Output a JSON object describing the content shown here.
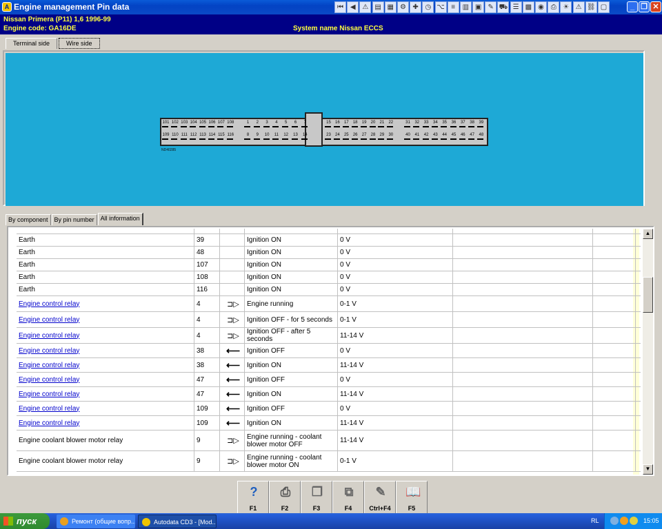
{
  "window": {
    "title": "Engine management Pin data",
    "app_icon": "autodata-icon"
  },
  "toolbar_icons": [
    "first-icon",
    "prev-icon",
    "warning-icon",
    "doc-icon",
    "chart-icon",
    "gear-icon",
    "tools-icon",
    "clock-icon",
    "tree-icon",
    "list-icon",
    "book-icon",
    "doc2-icon",
    "wrench-icon",
    "car-icon",
    "form-icon",
    "image-icon",
    "camera-icon",
    "print-icon",
    "bulb-icon",
    "warning2-icon",
    "link-icon",
    "frame-icon"
  ],
  "info": {
    "vehicle": "Nissan  Primera (P11) 1,6  1996-99",
    "engine_code": "Engine code: GA16DE",
    "system_name": "System name Nissan ECCS"
  },
  "view_tabs": [
    "Terminal side",
    "Wire side"
  ],
  "connector": {
    "code": "ND40285",
    "top_left": [
      "101",
      "102",
      "103",
      "104",
      "105",
      "106",
      "107",
      "108"
    ],
    "bottom_left": [
      "109",
      "110",
      "111",
      "112",
      "113",
      "114",
      "115",
      "116"
    ],
    "top_mid": [
      "1",
      "2",
      "3",
      "4",
      "5",
      "6",
      "7"
    ],
    "bottom_mid": [
      "8",
      "9",
      "10",
      "11",
      "12",
      "13",
      "14"
    ],
    "top_right_a": [
      "15",
      "16",
      "17",
      "18",
      "19",
      "20",
      "21",
      "22"
    ],
    "bottom_right_a": [
      "23",
      "24",
      "25",
      "26",
      "27",
      "28",
      "29",
      "30"
    ],
    "top_right_b": [
      "31",
      "32",
      "33",
      "34",
      "35",
      "36",
      "37",
      "38",
      "39"
    ],
    "bottom_right_b": [
      "40",
      "41",
      "42",
      "43",
      "44",
      "45",
      "46",
      "47",
      "48"
    ]
  },
  "info_tabs": [
    "By component",
    "By pin number",
    "All information"
  ],
  "rows": [
    {
      "component": "Earth",
      "pin": "39",
      "dir": "",
      "condition": "Ignition ON",
      "value": "0 V",
      "link": false
    },
    {
      "component": "Earth",
      "pin": "48",
      "dir": "",
      "condition": "Ignition ON",
      "value": "0 V",
      "link": false
    },
    {
      "component": "Earth",
      "pin": "107",
      "dir": "",
      "condition": "Ignition ON",
      "value": "0 V",
      "link": false
    },
    {
      "component": "Earth",
      "pin": "108",
      "dir": "",
      "condition": "Ignition ON",
      "value": "0 V",
      "link": false
    },
    {
      "component": "Earth",
      "pin": "116",
      "dir": "",
      "condition": "Ignition ON",
      "value": "0 V",
      "link": false
    },
    {
      "component": "Engine control relay",
      "pin": "4",
      "dir": "output",
      "condition": "Engine running",
      "value": "0-1 V",
      "link": true
    },
    {
      "component": "Engine control relay",
      "pin": "4",
      "dir": "output",
      "condition": "Ignition OFF - for 5 seconds",
      "value": "0-1 V",
      "link": true
    },
    {
      "component": "Engine control relay",
      "pin": "4",
      "dir": "output",
      "condition": "Ignition OFF - after 5 seconds",
      "value": "11-14 V",
      "link": true
    },
    {
      "component": "Engine control relay",
      "pin": "38",
      "dir": "input",
      "condition": "Ignition OFF",
      "value": "0 V",
      "link": true
    },
    {
      "component": "Engine control relay",
      "pin": "38",
      "dir": "input",
      "condition": "Ignition ON",
      "value": "11-14 V",
      "link": true
    },
    {
      "component": "Engine control relay",
      "pin": "47",
      "dir": "input",
      "condition": "Ignition OFF",
      "value": "0 V",
      "link": true
    },
    {
      "component": "Engine control relay",
      "pin": "47",
      "dir": "input",
      "condition": "Ignition ON",
      "value": "11-14 V",
      "link": true
    },
    {
      "component": "Engine control relay",
      "pin": "109",
      "dir": "input",
      "condition": "Ignition OFF",
      "value": "0 V",
      "link": true
    },
    {
      "component": "Engine control relay",
      "pin": "109",
      "dir": "input",
      "condition": "Ignition ON",
      "value": "11-14 V",
      "link": true
    },
    {
      "component": "Engine coolant blower motor relay",
      "pin": "9",
      "dir": "output",
      "condition": "Engine running - coolant blower motor OFF",
      "value": "11-14 V",
      "link": false
    },
    {
      "component": "Engine coolant blower motor relay",
      "pin": "9",
      "dir": "output",
      "condition": "Engine running - coolant blower motor ON",
      "value": "0-1 V",
      "link": false
    }
  ],
  "fkeys": [
    {
      "label": "F1",
      "icon": "help-icon"
    },
    {
      "label": "F2",
      "icon": "print-icon"
    },
    {
      "label": "F3",
      "icon": "copy-icon"
    },
    {
      "label": "F4",
      "icon": "export-icon"
    },
    {
      "label": "Ctrl+F4",
      "icon": "notes-icon"
    },
    {
      "label": "F5",
      "icon": "book-icon"
    }
  ],
  "taskbar": {
    "start": "пуск",
    "task1": "Ремонт (общие вопр...",
    "task2": "Autodata CD3 - [Mod...",
    "lang": "RL",
    "clock": "15:05"
  }
}
